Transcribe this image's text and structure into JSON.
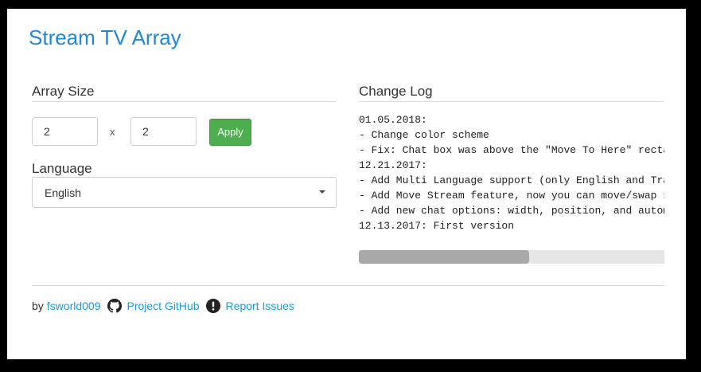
{
  "app": {
    "title": "Stream TV Array"
  },
  "array_size": {
    "heading": "Array Size",
    "rows_value": "2",
    "separator": "x",
    "cols_value": "2",
    "apply_label": "Apply"
  },
  "language": {
    "heading": "Language",
    "selected": "English"
  },
  "changelog": {
    "heading": "Change Log",
    "lines": [
      "01.05.2018:",
      "- Change color scheme",
      "- Fix: Chat box was above the \"Move To Here\" rectangle",
      "12.21.2017:",
      "- Add Multi Language support (only English and Traditional Chinese)",
      "- Add Move Stream feature, now you can move/swap streams",
      "- Add new chat options: width, position, and automatic hide",
      "12.13.2017: First version"
    ],
    "scroll_position_fraction": 0.0,
    "visible_fraction": 0.557
  },
  "footer": {
    "by_label": "by",
    "author": "fsworld009",
    "github_label": "Project GitHub",
    "issues_label": "Report Issues",
    "github_icon": "github-icon",
    "issues_icon": "exclamation-circle-icon"
  },
  "colors": {
    "title": "#1e88d8",
    "link": "#1a9bd7",
    "apply_button": "#4cae4c",
    "background": "#000000"
  }
}
